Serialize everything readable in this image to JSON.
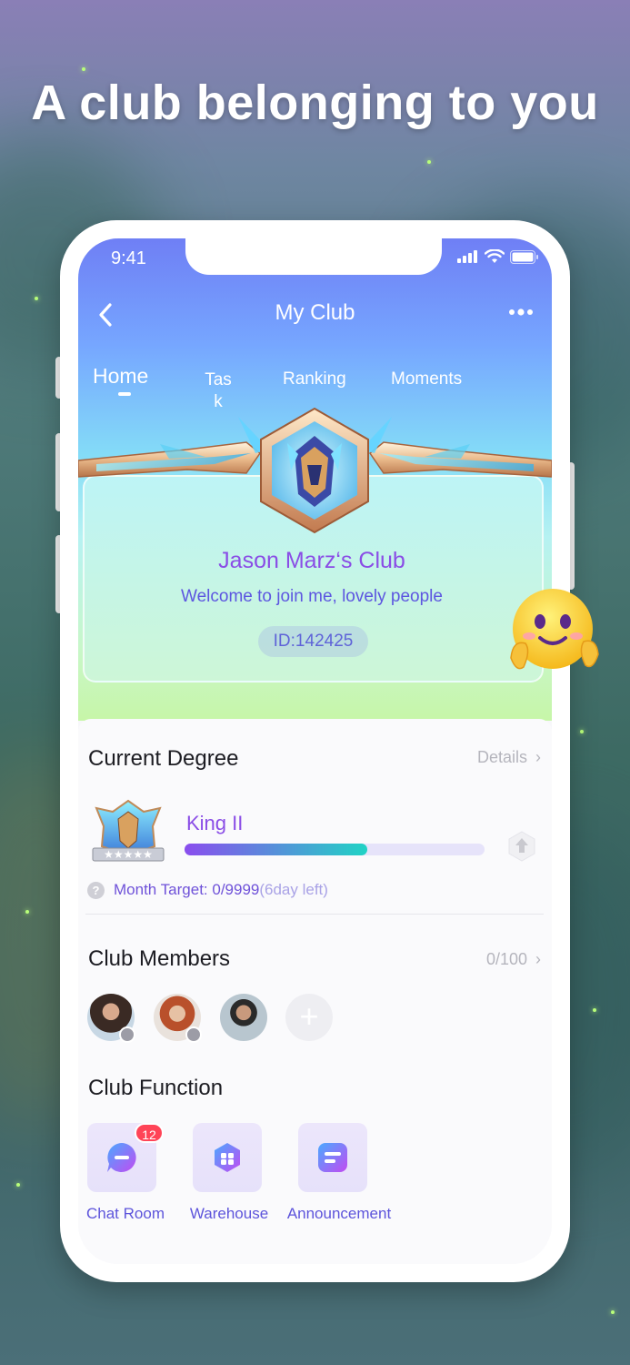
{
  "headline": "A club belonging to you",
  "status_bar": {
    "time": "9:41"
  },
  "nav": {
    "title": "My Club",
    "back_icon": "chevron-left-icon",
    "more_icon": "more-dots-icon"
  },
  "tabs": [
    {
      "label": "Home",
      "active": true
    },
    {
      "label": "Tas\nk",
      "active": false
    },
    {
      "label": "Ranking",
      "active": false
    },
    {
      "label": "Moments",
      "active": false
    }
  ],
  "club": {
    "name": "Jason Marz‘s Club",
    "description": "Welcome to join me, lovely people",
    "id_text": "ID:142425"
  },
  "degree": {
    "title": "Current Degree",
    "details_link": "Details",
    "level": "King II",
    "progress_percent": 61,
    "target_label": "Month Target: 0/9999",
    "days_left": "(6day left)",
    "help_icon": "?"
  },
  "members": {
    "title": "Club Members",
    "count": "0/100",
    "add_icon": "+"
  },
  "functions": {
    "title": "Club Function",
    "items": [
      {
        "label": "Chat Room",
        "icon": "chat-icon",
        "badge": "12"
      },
      {
        "label": "Warehouse",
        "icon": "warehouse-icon"
      },
      {
        "label": "Announcement",
        "icon": "announcement-icon"
      }
    ]
  },
  "colors": {
    "accent_purple": "#8a4de6",
    "link_blue": "#5d54db",
    "badge_red": "#ff4457"
  }
}
